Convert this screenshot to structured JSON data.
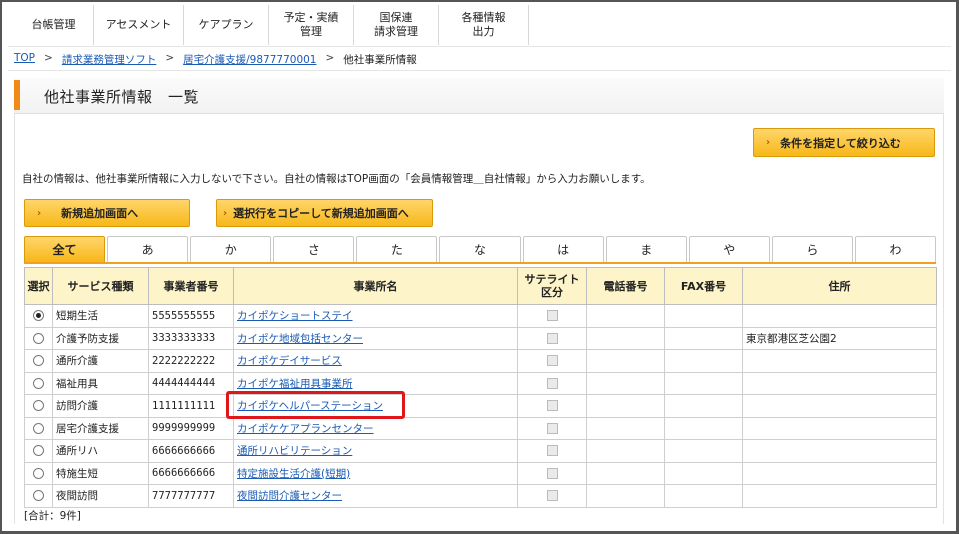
{
  "nav": {
    "items": [
      {
        "label": "台帳管理"
      },
      {
        "label": "アセスメント"
      },
      {
        "label": "ケアプラン"
      },
      {
        "label": "予定・実績\n管理"
      },
      {
        "label": "国保連\n請求管理"
      },
      {
        "label": "各種情報\n出力"
      }
    ]
  },
  "breadcrumb": {
    "top": "TOP",
    "sep": ">",
    "level1": "請求業務管理ソフト",
    "level2": "居宅介護支援/9877770001",
    "current": "他社事業所情報"
  },
  "page_title": "他社事業所情報　一覧",
  "filter_button": "条件を指定して絞り込む",
  "notice": "自社の情報は、他社事業所情報に入力しないで下さい。自社の情報はTOP画面の「会員情報管理＿自社情報」から入力お願いします。",
  "new_button": "新規追加画面へ",
  "copy_button": "選択行をコピーして新規追加画面へ",
  "tabs": [
    "全て",
    "あ",
    "か",
    "さ",
    "た",
    "な",
    "は",
    "ま",
    "や",
    "ら",
    "わ"
  ],
  "table": {
    "headers": {
      "select": "選択",
      "service": "サービス種類",
      "number": "事業者番号",
      "name": "事業所名",
      "satellite": "サテライト\n区分",
      "phone": "電話番号",
      "fax": "FAX番号",
      "address": "住所"
    },
    "rows": [
      {
        "service": "短期生活",
        "number": "5555555555",
        "name": "カイポケショートステイ",
        "address": "",
        "checked": true
      },
      {
        "service": "介護予防支援",
        "number": "3333333333",
        "name": "カイポケ地域包括センター",
        "address": "東京都港区芝公園2",
        "checked": false
      },
      {
        "service": "通所介護",
        "number": "2222222222",
        "name": "カイポケデイサービス",
        "address": "",
        "checked": false
      },
      {
        "service": "福祉用具",
        "number": "4444444444",
        "name": "カイポケ福祉用具事業所",
        "address": "",
        "checked": false
      },
      {
        "service": "訪問介護",
        "number": "1111111111",
        "name": "カイポケヘルパーステーション",
        "address": "",
        "checked": false
      },
      {
        "service": "居宅介護支援",
        "number": "9999999999",
        "name": "カイポケケアプランセンター",
        "address": "",
        "checked": false
      },
      {
        "service": "通所リハ",
        "number": "6666666666",
        "name": "通所リハビリテーション",
        "address": "",
        "checked": false
      },
      {
        "service": "特施生短",
        "number": "6666666666",
        "name": "特定施設生活介護(短期)",
        "address": "",
        "checked": false
      },
      {
        "service": "夜間訪問",
        "number": "7777777777",
        "name": "夜間訪問介護センター",
        "address": "",
        "checked": false
      }
    ]
  },
  "total": "[合計：9件]",
  "colors": {
    "accent": "#f7b718",
    "link": "#1a5bb5",
    "highlight": "#e0161b",
    "header_bg": "#fdf5c9"
  }
}
